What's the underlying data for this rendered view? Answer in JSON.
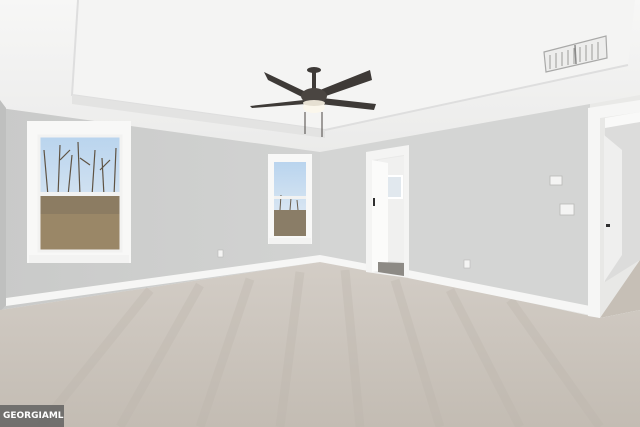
{
  "photo": {
    "subject": "empty-bedroom-interior",
    "features": [
      "ceiling-fan-with-light",
      "tray-ceiling",
      "two-windows",
      "open-doorway-to-bathroom",
      "hallway-doorway",
      "carpet-floor",
      "air-vent",
      "thermostat"
    ]
  },
  "colors": {
    "wall": "#cfd0cf",
    "ceiling": "#f2f2f1",
    "carpet": "#cbc5bd",
    "trim": "#f6f6f5",
    "fan": "#3e3a37"
  },
  "watermark": {
    "text": "GEORGIAMLS"
  }
}
